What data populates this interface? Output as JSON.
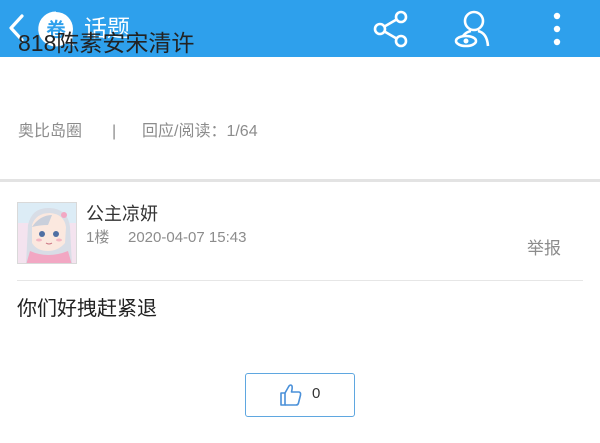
{
  "app": {
    "title": "话题",
    "logo_text": "卷",
    "icons": [
      "back-chevron-icon",
      "share-icon",
      "profile-icon",
      "more-vertical-icon"
    ],
    "accent_color": "#2ea0ec"
  },
  "topic": {
    "title": "818陈素安宋清许",
    "circle": "奥比岛圈",
    "separator": "|",
    "stats": "回应/阅读：1/64"
  },
  "post": {
    "author": "公主凉妍",
    "floor": "1楼",
    "timestamp": "2020-04-07 15:43",
    "report_label": "举报",
    "content": "你们好拽赶紧退",
    "like_count": "0"
  }
}
